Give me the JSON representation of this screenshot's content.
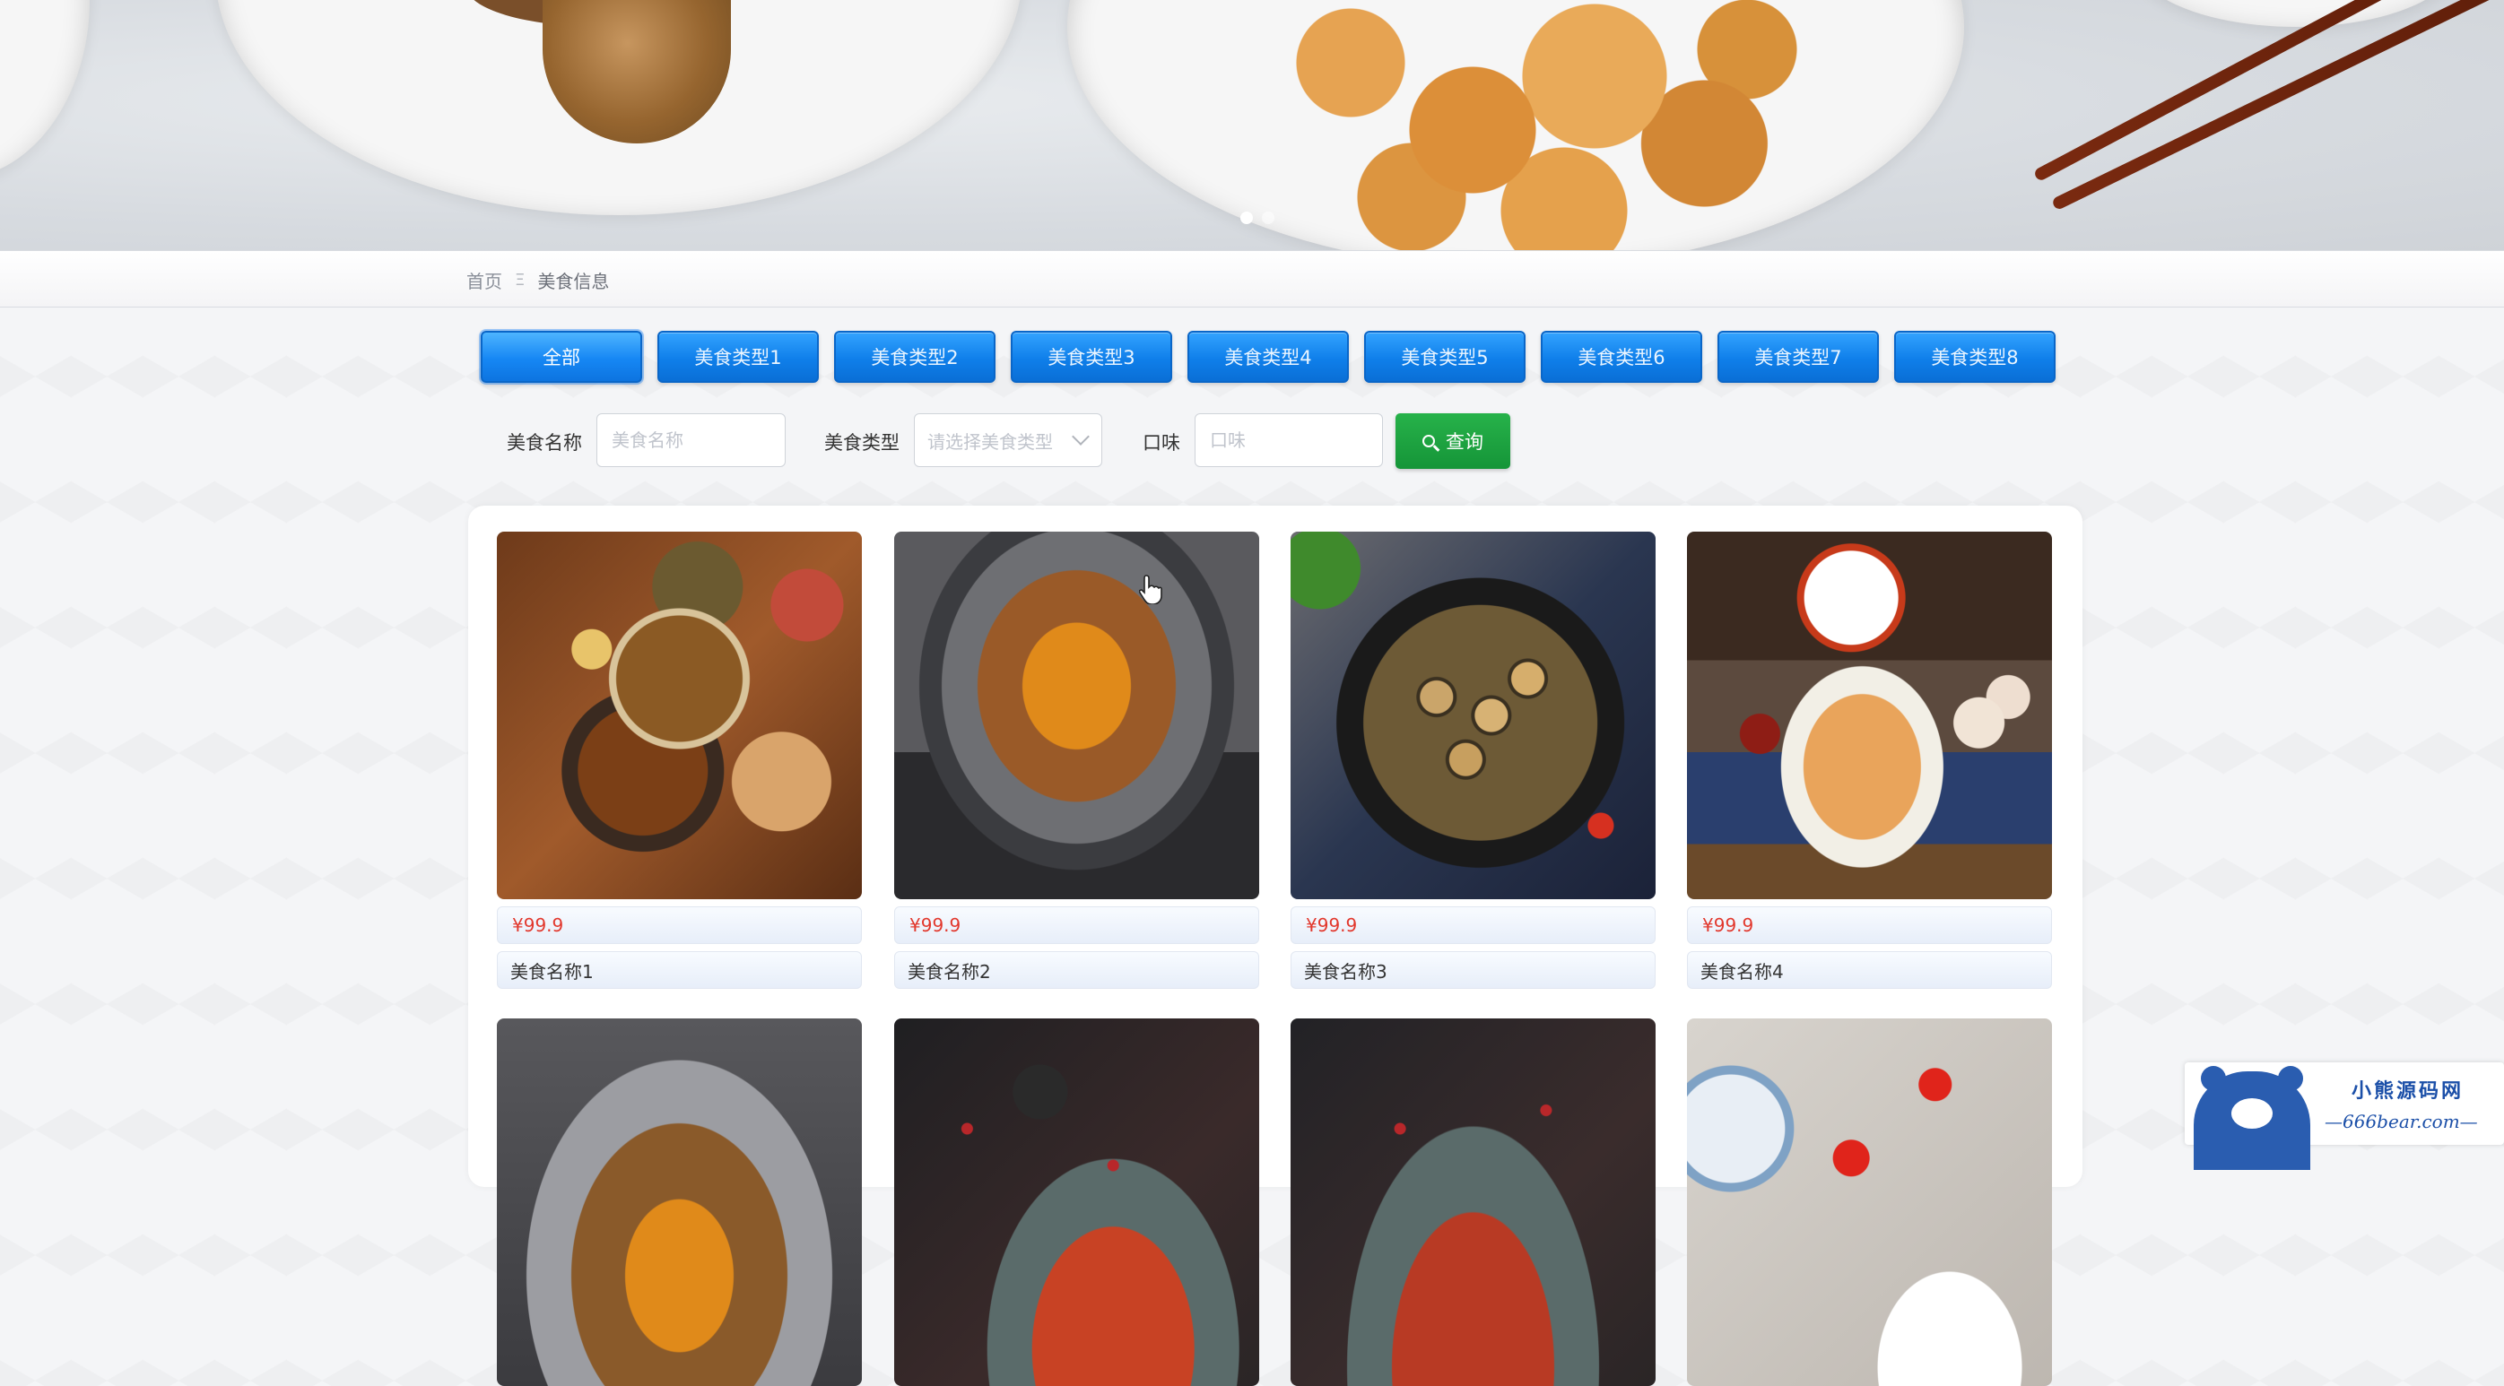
{
  "banner": {
    "slide_count": 2,
    "active_slide": 1
  },
  "breadcrumb": {
    "home": "首页",
    "separator": "Ξ",
    "current": "美食信息"
  },
  "categories": [
    "全部",
    "美食类型1",
    "美食类型2",
    "美食类型3",
    "美食类型4",
    "美食类型5",
    "美食类型6",
    "美食类型7",
    "美食类型8"
  ],
  "active_category": "全部",
  "search": {
    "name_label": "美食名称",
    "name_placeholder": "美食名称",
    "type_label": "美食类型",
    "type_placeholder": "请选择美食类型",
    "taste_label": "口味",
    "taste_placeholder": "口味",
    "button_label": "查询"
  },
  "items": [
    {
      "price": "¥99.9",
      "name": "美食名称1"
    },
    {
      "price": "¥99.9",
      "name": "美食名称2"
    },
    {
      "price": "¥99.9",
      "name": "美食名称3"
    },
    {
      "price": "¥99.9",
      "name": "美食名称4"
    },
    {
      "price": "",
      "name": ""
    },
    {
      "price": "",
      "name": ""
    },
    {
      "price": "",
      "name": ""
    },
    {
      "price": "",
      "name": ""
    }
  ],
  "watermark": {
    "title": "小熊源码网",
    "site": "—666bear.com—"
  },
  "colors": {
    "tab_blue": "#0f7fea",
    "search_green": "#159538",
    "price_red": "#e2382d"
  }
}
